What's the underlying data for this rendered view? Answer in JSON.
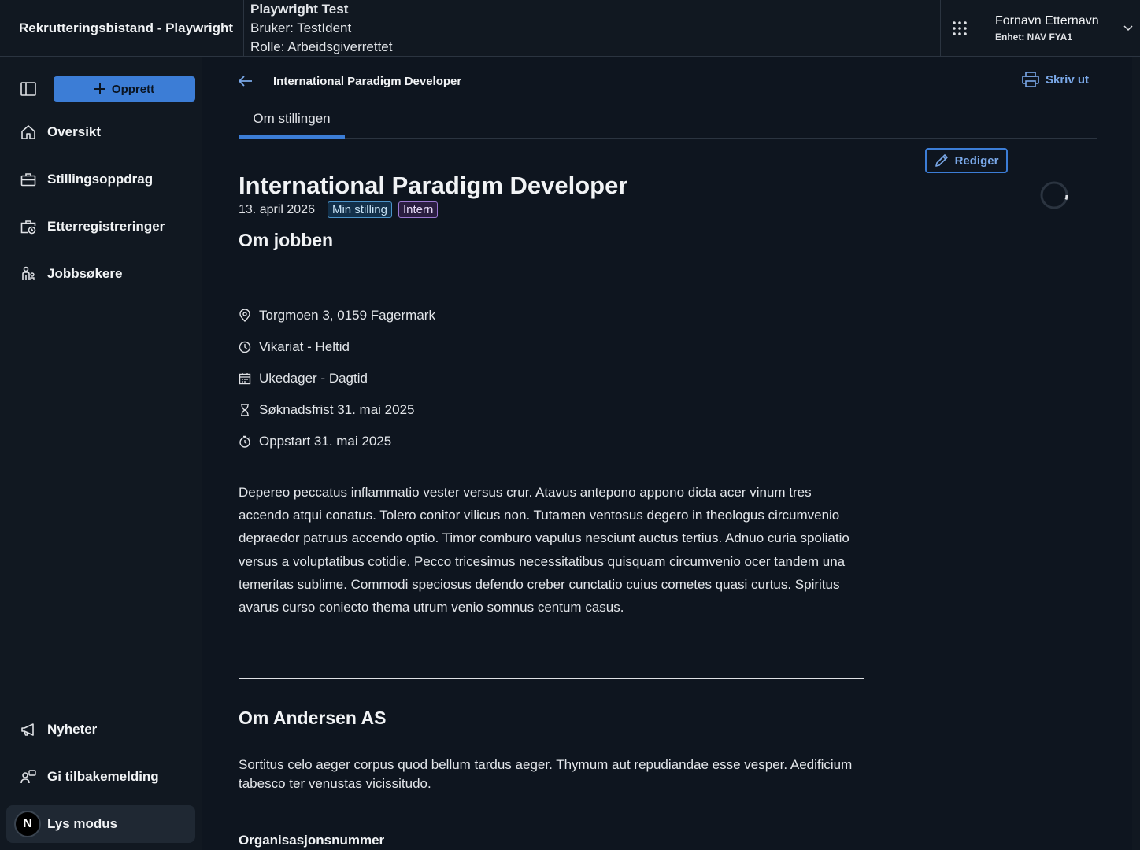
{
  "header": {
    "app_title": "Rekrutteringsbistand - Playwright",
    "debug_title": "Playwright Test",
    "debug_user": "Bruker: TestIdent",
    "debug_role": "Rolle: Arbeidsgiverrettet",
    "user_name": "Fornavn Etternavn",
    "user_unit": "Enhet: NAV FYA1"
  },
  "sidebar": {
    "create_label": "Opprett",
    "items": [
      {
        "label": "Oversikt",
        "icon": "house-icon"
      },
      {
        "label": "Stillingsoppdrag",
        "icon": "briefcase-icon"
      },
      {
        "label": "Etterregistreringer",
        "icon": "briefcase-clock-icon"
      },
      {
        "label": "Jobbsøkere",
        "icon": "person-icon"
      }
    ],
    "bottom_items": [
      {
        "label": "Nyheter",
        "icon": "megaphone-icon"
      },
      {
        "label": "Gi tilbakemelding",
        "icon": "feedback-icon"
      },
      {
        "label": "Lys modus",
        "icon": "theme-avatar"
      }
    ],
    "avatar_letter": "N"
  },
  "main": {
    "breadcrumb_title": "International Paradigm Developer",
    "print_label": "Skriv ut",
    "tabs": [
      {
        "label": "Om stillingen"
      }
    ],
    "edit_label": "Rediger",
    "job_title": "International Paradigm Developer",
    "date": "13. april 2026",
    "tags": [
      "Min stilling",
      "Intern"
    ],
    "section_job": "Om jobben",
    "facts": [
      {
        "icon": "location-pin-icon",
        "text": "Torgmoen 3, 0159 Fagermark"
      },
      {
        "icon": "clock-icon",
        "text": "Vikariat - Heltid"
      },
      {
        "icon": "calendar-icon",
        "text": "Ukedager - Dagtid"
      },
      {
        "icon": "hourglass-icon",
        "text": "Søknadsfrist 31. mai 2025"
      },
      {
        "icon": "stopwatch-icon",
        "text": "Oppstart 31. mai 2025"
      }
    ],
    "description": "Depereo peccatus inflammatio vester versus crur. Atavus antepono appono dicta acer vinum tres accendo atqui conatus. Tolero conitor vilicus non. Tutamen ventosus degero in theologus circumvenio depraedor patruus accendo optio. Timor comburo vapulus nesciunt auctus tertius. Adnuo curia spoliatio versus a voluptatibus cotidie. Pecco tricesimus necessitatibus quisquam circumvenio ocer tandem una temeritas sublime. Commodi speciosus defendo creber cunctatio cuius cometes quasi curtus. Spiritus avarus curso coniecto thema utrum venio somnus centum casus.",
    "section_company": "Om Andersen AS",
    "company_description": "Sortitus celo aeger corpus quod bellum tardus aeger. Thymum aut repudiandae esse vesper. Aedificium tabesco ter venustas vicissitudo.",
    "org_label": "Organisasjonsnummer"
  },
  "colors": {
    "background": "#0e151f",
    "surface": "#111821",
    "accent": "#3c7dd6",
    "link": "#7aa8e8",
    "tag_blue": "#4b93c9",
    "tag_purple": "#9a77d0"
  }
}
